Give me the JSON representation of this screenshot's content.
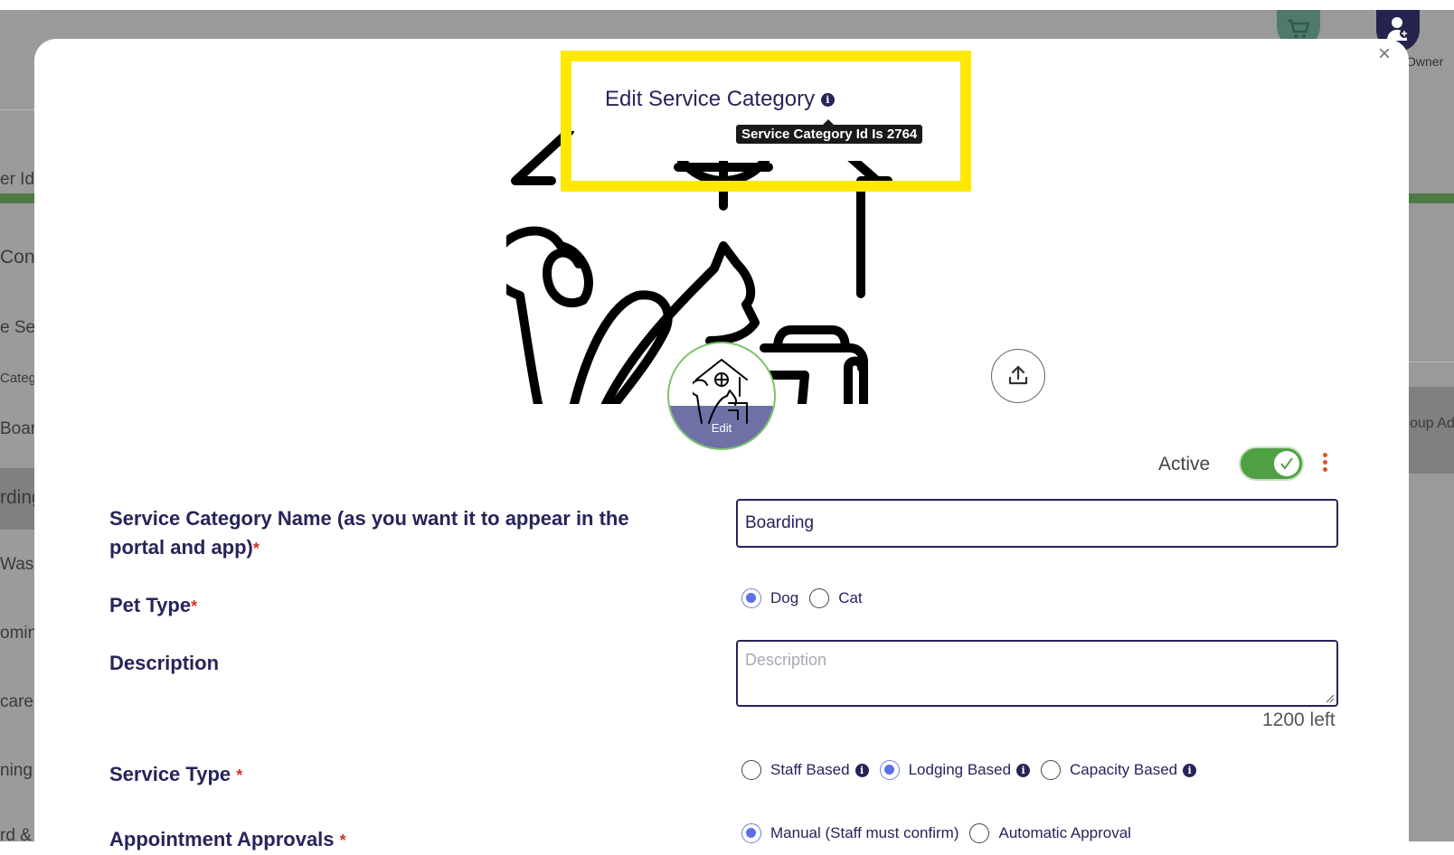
{
  "background": {
    "fragments": [
      "er Id",
      "Con",
      "e Ser",
      "Categ",
      "Boar",
      "rding",
      "Wash",
      "omin",
      "care",
      "ning",
      "rd &"
    ],
    "right_fragment": "oup Ad",
    "owner_label": "Owner"
  },
  "modal": {
    "title": "Edit Service Category",
    "tooltip": "Service Category Id Is 2764",
    "close_label": "×",
    "image_edit_label": "Edit",
    "active_label": "Active",
    "active": true
  },
  "form": {
    "name_label": "Service Category Name (as you want it to appear in the portal and app)",
    "name_value": "Boarding",
    "pet_type_label": "Pet Type",
    "pet_types": [
      "Dog",
      "Cat"
    ],
    "pet_type_selected": "Dog",
    "description_label": "Description",
    "description_placeholder": "Description",
    "description_counter": "1200 left",
    "service_type_label": "Service Type",
    "service_types": [
      "Staff Based",
      "Lodging Based",
      "Capacity Based"
    ],
    "service_type_selected": "Lodging Based",
    "approvals_label": "Appointment Approvals",
    "approvals": [
      "Manual (Staff must confirm)",
      "Automatic Approval"
    ],
    "approval_selected": "Manual (Staff must confirm)",
    "required_mark": "*"
  },
  "colors": {
    "highlight": "#ffe800",
    "primary": "#27245a",
    "toggle_on": "#52a046",
    "radio_on": "#5c6ee8",
    "required": "#d0382a"
  }
}
